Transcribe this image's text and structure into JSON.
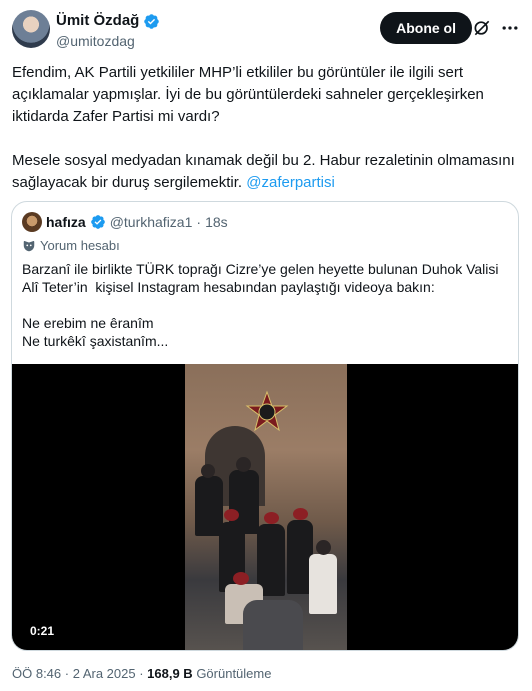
{
  "author": {
    "name": "Ümit Özdağ",
    "handle": "@umitozdag",
    "verified_color": "#1d9bf0"
  },
  "follow_button": {
    "label": "Abone ol"
  },
  "icons": {
    "grok": "grok-icon",
    "more": "more-icon",
    "verified": "verified-badge-icon"
  },
  "tweet": {
    "paragraph1": "Efendim, AK Partili yetkililer MHP’li etkililer bu görüntüler ile ilgili sert açıklamalar yapmışlar. İyi de bu görüntülerdeki sahneler gerçekleşirken iktidarda Zafer Partisi mi vardı?",
    "paragraph2": "Mesele sosyal medyadan kınamak değil bu 2. Habur rezaletinin olmamasını sağlayacak bir duruş sergilemektir. ",
    "hashtag": "@zaferpartisi"
  },
  "quote": {
    "name": "hafıza",
    "handle": "@turkhafiza1",
    "separator": "·",
    "time": "18s",
    "label": "Yorum hesabı",
    "text_line1": "Barzanî ile birlikte TÜRK toprağı Cizre’ye gelen heyette bulunan Duhok Valisi Alî Teter’in  kişisel Instagram hesabından paylaştığı videoya bakın:",
    "text_line2": "Ne erebim ne êranîm",
    "text_line3": "Ne turkêkî şaxistanîm...",
    "video_time": "0:21"
  },
  "meta": {
    "time": "ÖÖ 8:46",
    "separator1": " · ",
    "date": "2 Ara 2025",
    "separator2": " · ",
    "views_count": "168,9 B",
    "views_label": " Görüntüleme"
  }
}
